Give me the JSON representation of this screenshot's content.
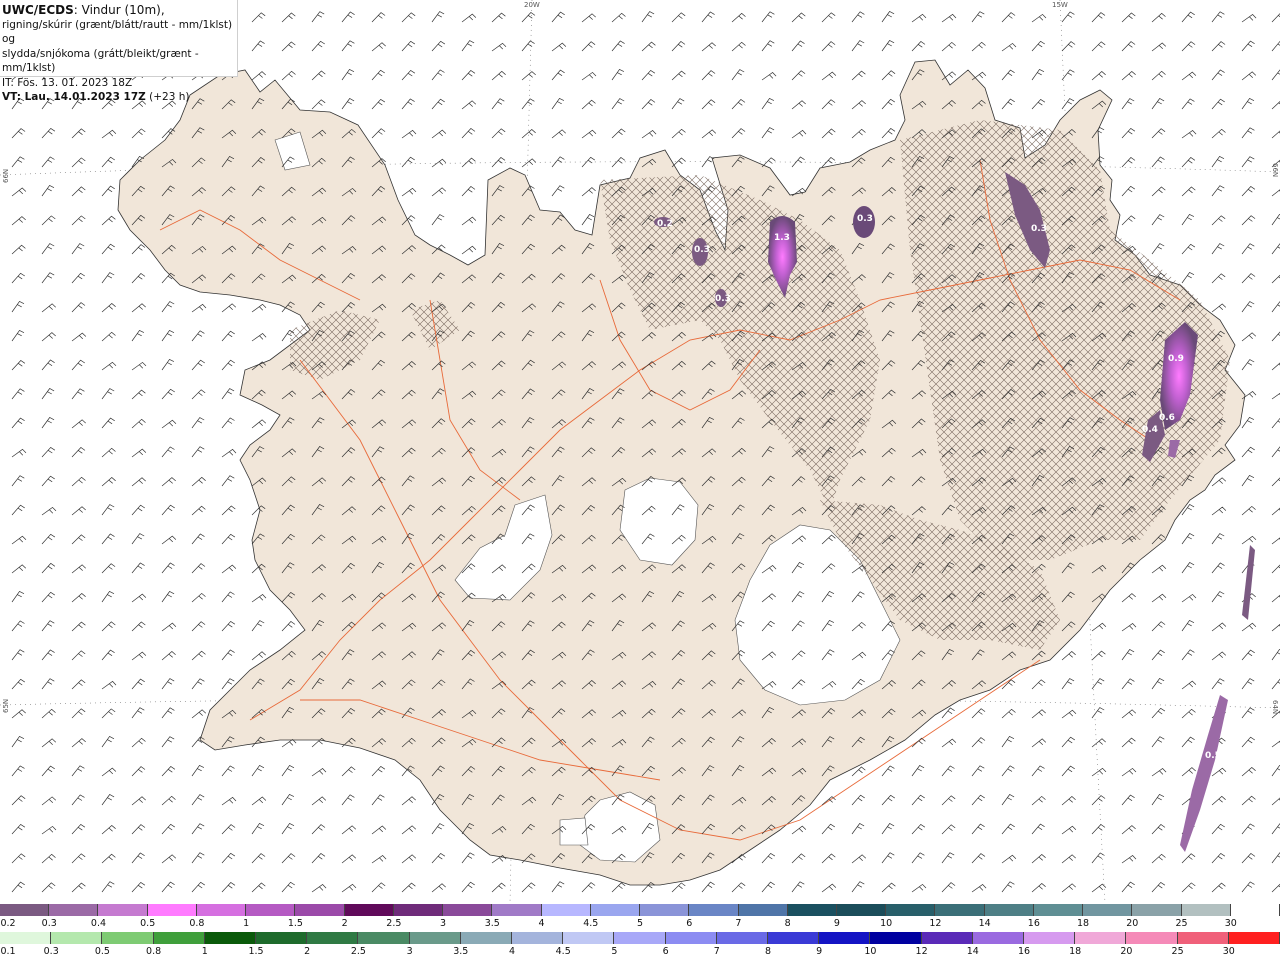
{
  "header": {
    "model": "UWC/ECDS",
    "line1_rest": ": Vindur (10m),",
    "line2": "rigning/skúrir (grænt/blátt/rautt - mm/1klst) og",
    "line3": "slydda/snjókoma (grátt/bleikt/grænt - mm/1klst)",
    "issue_time": "IT: Fös. 13. 01. 2023 18Z",
    "valid_time_bold": "VT: Lau. 14.01.2023 17Z",
    "valid_time_offset": " (+23 h)"
  },
  "grid_labels": {
    "top_left_lon": "20W",
    "top_right_lon": "15W",
    "left_lat_top": "66N",
    "left_lat_bottom": "65N",
    "right_lat_top": "66N",
    "right_lat_bottom": "64N"
  },
  "precip_cells": [
    {
      "label": "0.2"
    },
    {
      "label": "0.3"
    },
    {
      "label": "0.3"
    },
    {
      "label": "1.3"
    },
    {
      "label": "0.3"
    },
    {
      "label": "0.3"
    },
    {
      "label": "0.9"
    },
    {
      "label": "0.6"
    },
    {
      "label": "0.4"
    },
    {
      "label": "0.5"
    }
  ],
  "legend": {
    "snow_scale": {
      "labels": [
        "0.2",
        "0.3",
        "0.4",
        "0.5",
        "0.8",
        "1",
        "1.5",
        "2",
        "2.5",
        "3",
        "3.5",
        "4",
        "4.5",
        "5",
        "6",
        "7",
        "8",
        "9",
        "10",
        "12",
        "14",
        "16",
        "18",
        "20",
        "25",
        "30"
      ],
      "colors": [
        "#7b5a82",
        "#9b6aa6",
        "#c57ad0",
        "#ff7bff",
        "#d56fe0",
        "#b55ac3",
        "#9b4aa9",
        "#600a5a",
        "#6f2b7a",
        "#8a4a9a",
        "#a07ac7",
        "#b7b7ff",
        "#9aa6ef",
        "#8a94d8",
        "#6a86c6",
        "#4f75a8",
        "#1a5060",
        "#1b4d5a",
        "#285f6a",
        "#3b6f78",
        "#4e7f86",
        "#5f8f94",
        "#7196a0",
        "#8aa2a8",
        "#b2c0c0",
        "#ffffff"
      ]
    },
    "rain_scale": {
      "labels": [
        "0.1",
        "0.3",
        "0.5",
        "0.8",
        "1",
        "1.5",
        "2",
        "2.5",
        "3",
        "3.5",
        "4",
        "4.5",
        "5",
        "6",
        "7",
        "8",
        "9",
        "10",
        "12",
        "14",
        "16",
        "18",
        "20",
        "25",
        "30"
      ],
      "colors": [
        "#dff7dc",
        "#b4e8ad",
        "#7ecb73",
        "#3f9f3b",
        "#0a5a0a",
        "#1e6b2c",
        "#2f7a44",
        "#4a8a64",
        "#6a9a8a",
        "#8aaab6",
        "#a4b4dc",
        "#c0c8f4",
        "#a8a8f8",
        "#8c8cf2",
        "#6a6ae6",
        "#3a3ad6",
        "#1414c4",
        "#0000a0",
        "#5a2ab8",
        "#9a6ae0",
        "#d69aef",
        "#f0a8d8",
        "#f58ab8",
        "#f0607a",
        "#ff2020"
      ]
    }
  }
}
